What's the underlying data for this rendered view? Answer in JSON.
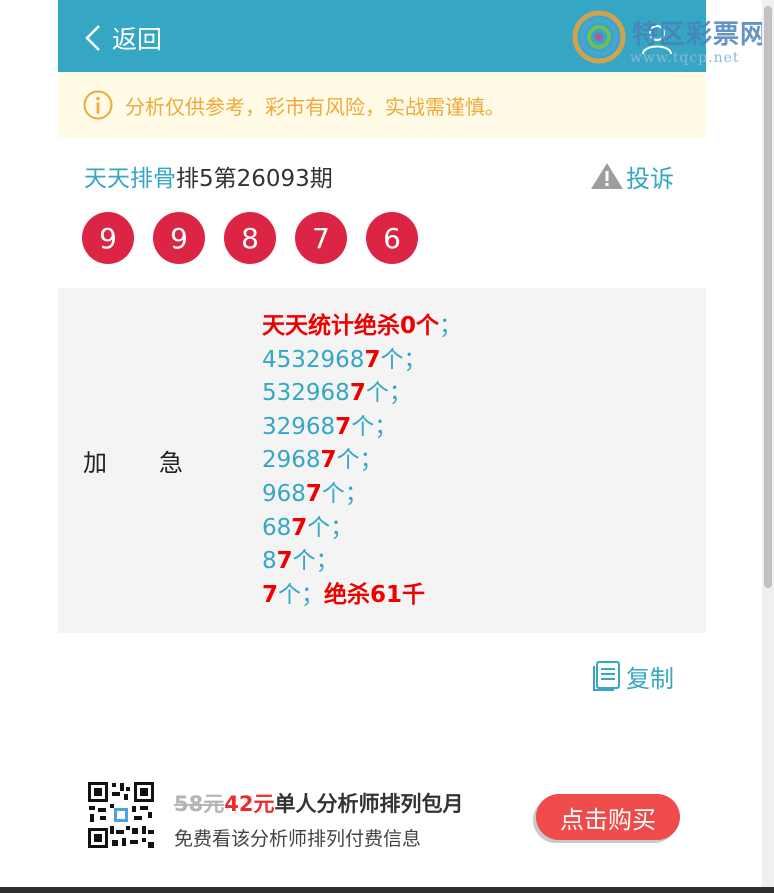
{
  "header": {
    "back_label": "返回"
  },
  "watermark": {
    "title": "特区彩票网",
    "url": "www.tqcp.net"
  },
  "notice": {
    "text": "分析仅供参考，彩市有风险，实战需谨慎。"
  },
  "lottery": {
    "analyst_name": "天天排骨",
    "issue_text": "排5第26093期",
    "complain_label": "投诉",
    "numbers": [
      "9",
      "9",
      "8",
      "7",
      "6"
    ]
  },
  "analysis": {
    "label_part1": "加",
    "label_part2": "急",
    "lines": [
      {
        "text": "",
        "red": "天天统计绝杀0个",
        "tail": "；"
      },
      {
        "text": "4532968",
        "red": "7",
        "tail": "个；"
      },
      {
        "text": "532968",
        "red": "7",
        "tail": "个；"
      },
      {
        "text": "32968",
        "red": "7",
        "tail": "个；"
      },
      {
        "text": "2968",
        "red": "7",
        "tail": "个；"
      },
      {
        "text": "968",
        "red": "7",
        "tail": "个；"
      },
      {
        "text": "68",
        "red": "7",
        "tail": "个；"
      },
      {
        "text": "8",
        "red": "7",
        "tail": "个；"
      }
    ],
    "last_line": {
      "red": "7",
      "mid": "个；",
      "red2": "绝杀61千"
    }
  },
  "copy": {
    "label": "复制"
  },
  "promo": {
    "old_price": "58元",
    "new_price": "42元",
    "title": "单人分析师排列包月",
    "subtitle": "免费看该分析师排列付费信息",
    "buy_label": "点击购买"
  },
  "colors": {
    "header_bg": "#35a6c3",
    "ball_red": "#dc2544",
    "notice_text": "#f0a93a",
    "buy_button": "#ef4b4b"
  }
}
